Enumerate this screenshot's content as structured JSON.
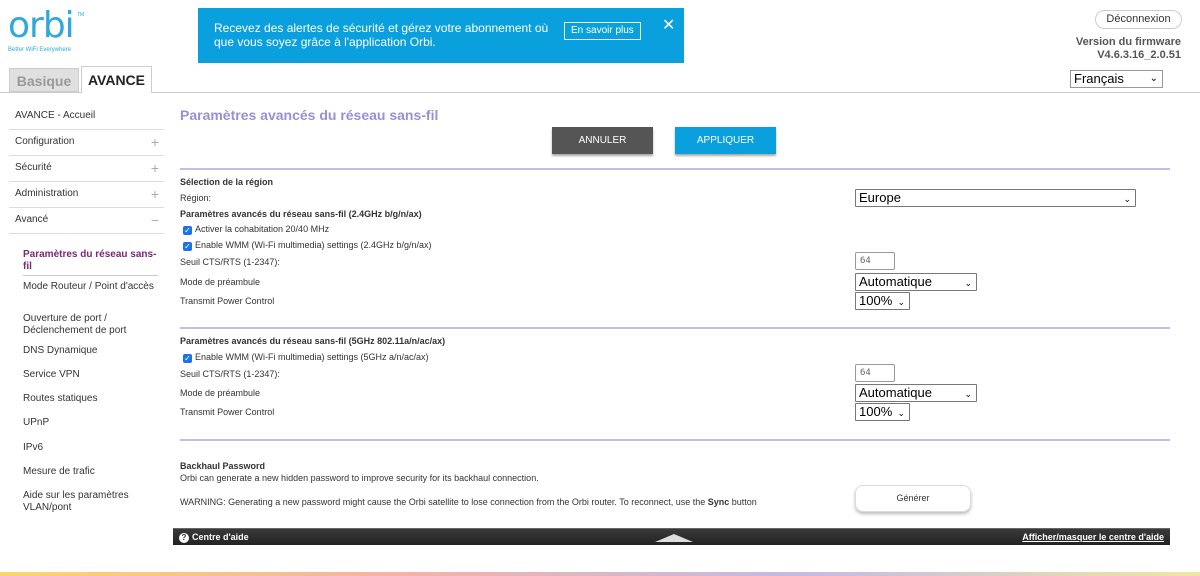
{
  "brand": {
    "name": "orbi",
    "tm": "TM",
    "tagline": "Better WiFi Everywhere"
  },
  "banner": {
    "text": "Recevez des alertes de sécurité et gérez votre abonnement où que vous soyez grâce à l'application Orbi.",
    "button": "En savoir plus",
    "close": "✕"
  },
  "header": {
    "logout": "Déconnexion",
    "firmware_label": "Version du firmware",
    "firmware_version": "V4.6.3.16_2.0.51",
    "language": "Français"
  },
  "tabs": {
    "basic": "Basique",
    "advanced": "AVANCE"
  },
  "sidebar": {
    "items": [
      {
        "label": "AVANCE - Accueil",
        "expander": ""
      },
      {
        "label": "Configuration",
        "expander": "+"
      },
      {
        "label": "Sécurité",
        "expander": "+"
      },
      {
        "label": "Administration",
        "expander": "+"
      },
      {
        "label": "Avancé",
        "expander": "−"
      }
    ],
    "subitems": [
      "Paramètres du réseau sans-fil",
      "Mode Routeur / Point d'accès",
      "Ouverture de port / Déclenchement de port",
      "DNS Dynamique",
      "Service VPN",
      "Routes statiques",
      "UPnP",
      "IPv6",
      "Mesure de trafic",
      "Aide sur les paramètres VLAN/pont"
    ]
  },
  "main": {
    "title": "Paramètres avancés du réseau sans-fil",
    "cancel": "ANNULER",
    "apply": "APPLIQUER",
    "region_section": "Sélection de la région",
    "region_label": "Région:",
    "region_value": "Europe",
    "band24": {
      "heading": "Paramètres avancés du réseau sans-fil (2.4GHz b/g/n/ax)",
      "cb1": "Activer la cohabitation 20/40 MHz",
      "cb2": "Enable WMM (Wi-Fi multimedia) settings (2.4GHz b/g/n/ax)",
      "cts_label": "Seuil CTS/RTS (1-2347):",
      "cts_value": "64",
      "preamble_label": "Mode de préambule",
      "preamble_value": "Automatique",
      "tpc_label": "Transmit Power Control",
      "tpc_value": "100%"
    },
    "band5": {
      "heading": "Paramètres avancés du réseau sans-fil (5GHz 802.11a/n/ac/ax)",
      "cb1": "Enable WMM (Wi-Fi multimedia) settings (5GHz a/n/ac/ax)",
      "cts_label": "Seuil CTS/RTS (1-2347):",
      "cts_value": "64",
      "preamble_label": "Mode de préambule",
      "preamble_value": "Automatique",
      "tpc_label": "Transmit Power Control",
      "tpc_value": "100%"
    },
    "backhaul": {
      "heading": "Backhaul Password",
      "desc": "Orbi can generate a new hidden password to improve security for its backhaul connection.",
      "warning": "WARNING: Generating a new password might cause the Orbi satellite to lose connection from the Orbi router. To reconnect, use the ",
      "warning_bold": "Sync",
      "warning_end": " button",
      "generate": "Générer"
    }
  },
  "help": {
    "left": "Centre d'aide",
    "icon": "?",
    "right": "Afficher/masquer le centre d'aide"
  },
  "colors": {
    "accent": "#0aa0de",
    "title": "#9a8fd3",
    "active_nav": "#7a2872"
  }
}
